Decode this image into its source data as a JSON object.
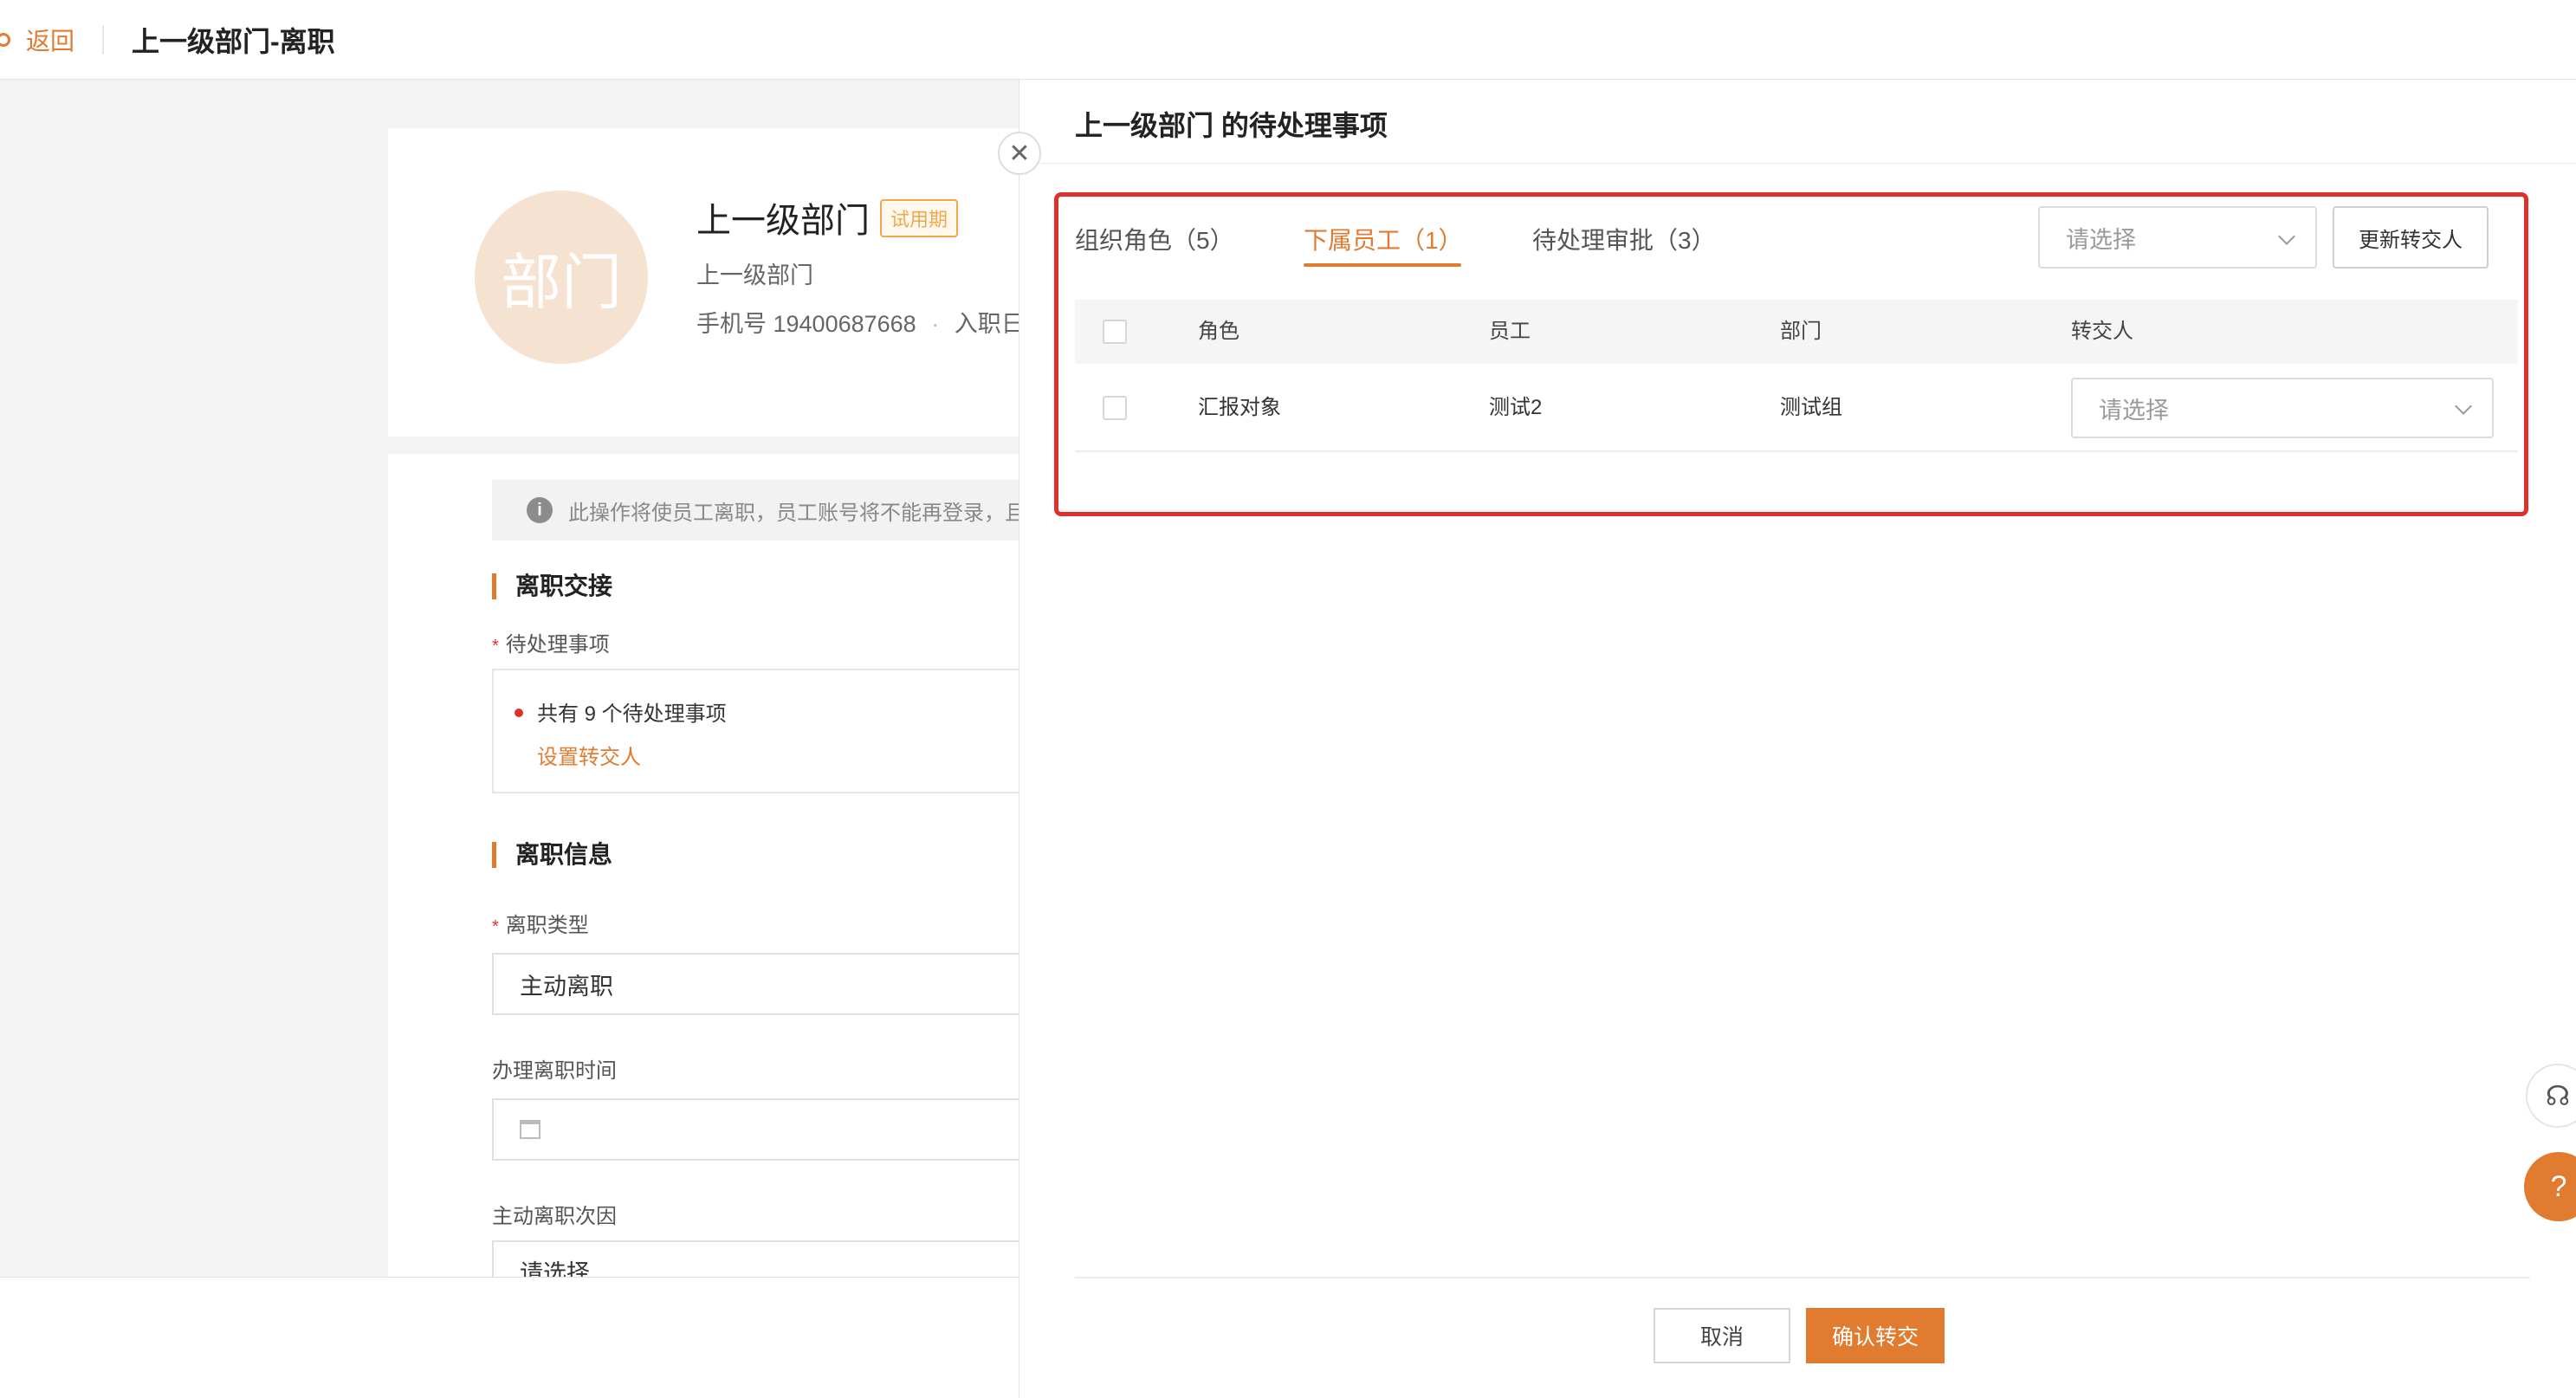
{
  "header": {
    "back_label": "返回",
    "page_title": "上一级部门-离职"
  },
  "profile": {
    "avatar_text": "部门",
    "name": "上一级部门",
    "badge": "试用期",
    "department": "上一级部门",
    "phone": "手机号 19400687668",
    "meta_separator": "·",
    "entry_label": "入职日"
  },
  "form": {
    "notice": "此操作将使员工离职，员工账号将不能再登录，且",
    "handover_title": "离职交接",
    "pending_label": "待处理事项",
    "pending_summary": "共有 9 个待处理事项",
    "set_transfer_link": "设置转交人",
    "info_title": "离职信息",
    "type_label": "离职类型",
    "type_value": "主动离职",
    "time_label": "办理离职时间",
    "reason_label": "主动离职次因",
    "reason_value": "请选择"
  },
  "drawer": {
    "title": "上一级部门 的待处理事项",
    "tabs": [
      {
        "label": "组织角色（5）"
      },
      {
        "label": "下属员工（1）"
      },
      {
        "label": "待处理审批（3）"
      }
    ],
    "active_tab": 1,
    "batch_select_placeholder": "请选择",
    "update_button": "更新转交人",
    "table": {
      "headers": [
        "角色",
        "员工",
        "部门",
        "转交人"
      ],
      "rows": [
        {
          "role": "汇报对象",
          "employee": "测试2",
          "department": "测试组",
          "transferee_placeholder": "请选择"
        }
      ]
    },
    "cancel_button": "取消",
    "confirm_button": "确认转交"
  },
  "icons": {
    "close": "close-icon",
    "info": "info-icon",
    "calendar": "calendar-icon",
    "headset": "headset-icon",
    "chat": "chat-help-icon"
  },
  "colors": {
    "accent": "#e07b30",
    "highlight": "#e0302c"
  }
}
